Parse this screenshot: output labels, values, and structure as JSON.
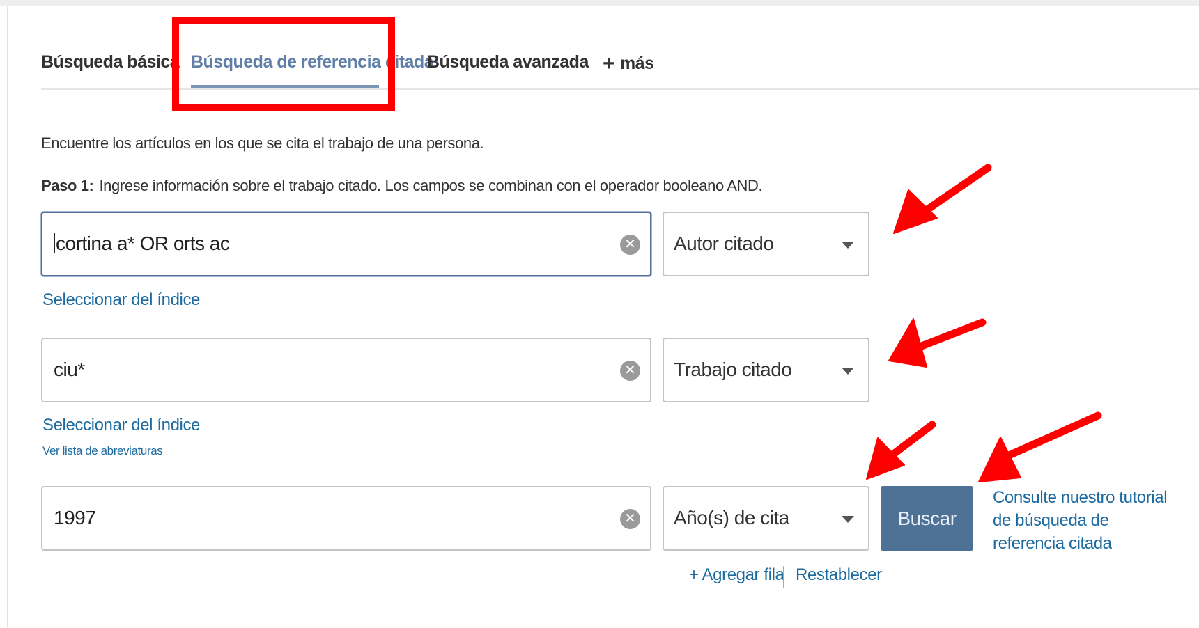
{
  "tabs": {
    "basic": "Búsqueda básica",
    "cited": "Búsqueda de referencia citada",
    "advanced": "Búsqueda avanzada",
    "more_plus": "+",
    "more": "más"
  },
  "intro_text": "Encuentre los artículos en los que se cita el trabajo de una persona.",
  "step": {
    "label": "Paso 1:",
    "text": "Ingrese información sobre el trabajo citado. Los campos se combinan con el operador booleano AND."
  },
  "rows": [
    {
      "value": "cortina a* OR orts ac",
      "field": "Autor citado"
    },
    {
      "value": "ciu*",
      "field": "Trabajo citado"
    },
    {
      "value": "1997",
      "field": "Año(s) de cita"
    }
  ],
  "links": {
    "select_index": "Seleccionar del índice",
    "abbreviations": "Ver lista de abreviaturas",
    "add_row": "+ Agregar fila",
    "reset": "Restablecer"
  },
  "search_button": "Buscar",
  "tutorial": {
    "line1": "Consulte nuestro tutorial",
    "line2": "de búsqueda de",
    "line3": "referencia citada"
  },
  "icons": {
    "clear": "clear-icon",
    "dropdown": "chevron-down-icon"
  },
  "colors": {
    "annotation": "#ff0000",
    "active_tab": "#5f7fa8",
    "link": "#1c6aa0",
    "button": "#4e7196"
  }
}
